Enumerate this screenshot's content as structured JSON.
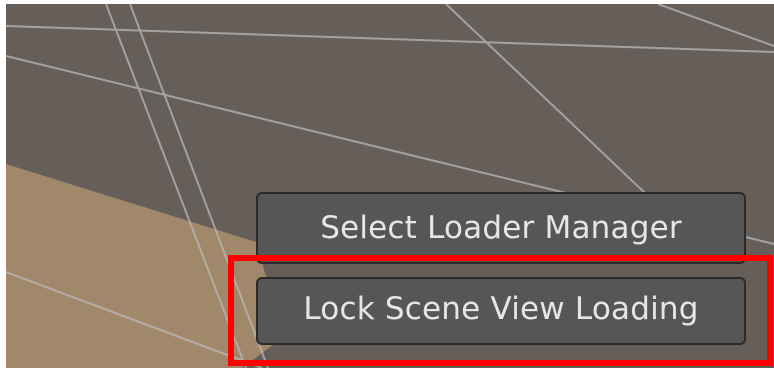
{
  "scene_view": {
    "background_color": "#655e59",
    "ground_color": "#a2886a",
    "grid_line_color": "#b9b9b9"
  },
  "buttons": {
    "select_loader_manager": "Select Loader Manager",
    "lock_scene_view_loading": "Lock Scene View Loading"
  },
  "highlight": {
    "color": "#ff0000",
    "target": "lock_scene_view_loading"
  }
}
